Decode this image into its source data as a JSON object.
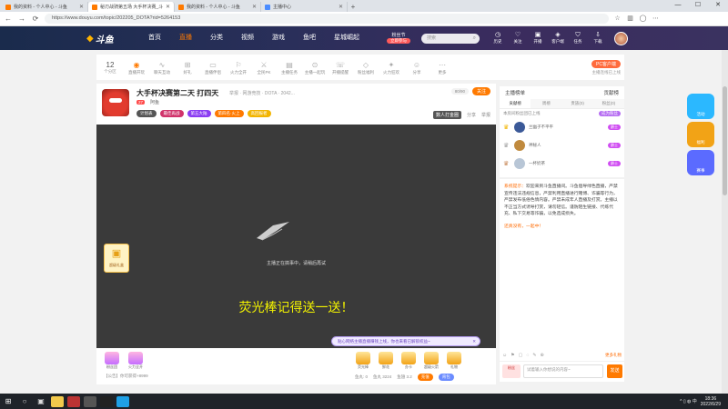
{
  "browser": {
    "tabs": [
      {
        "title": "我的资料 - 个人中心 - 斗鱼",
        "active": false
      },
      {
        "title": "秘刃战骑第五场 大手杯决赛_斗鱼直播平台",
        "active": true
      },
      {
        "title": "我的资料 - 个人中心 - 斗鱼",
        "active": false
      },
      {
        "title": "主播中心",
        "active": false
      }
    ],
    "url": "https://www.douyu.com/topic/202205_DOTA?rid=5264153",
    "new_tab": "+",
    "window_controls": [
      "—",
      "☐",
      "✕"
    ],
    "nav": {
      "back": "←",
      "forward": "→",
      "reload": "⟳"
    }
  },
  "site": {
    "logo_main": "斗鱼",
    "nav": [
      {
        "label": "首页",
        "active": false
      },
      {
        "label": "直播",
        "active": true
      },
      {
        "label": "分类",
        "active": false
      },
      {
        "label": "视频",
        "active": false
      },
      {
        "label": "游戏",
        "active": false
      },
      {
        "label": "鱼吧",
        "active": false
      },
      {
        "label": "星城崛起",
        "active": false
      }
    ],
    "festival": {
      "title": "粉丝节",
      "button": "立即参与"
    },
    "search_placeholder": "搜索",
    "header_icons": [
      {
        "icon": "history-icon",
        "glyph": "◷",
        "label": "历史"
      },
      {
        "icon": "follow-icon",
        "glyph": "♡",
        "label": "关注"
      },
      {
        "icon": "broadcast-icon",
        "glyph": "▣",
        "label": "开播"
      },
      {
        "icon": "customer-icon",
        "glyph": "◈",
        "label": "客户端"
      },
      {
        "icon": "task-icon",
        "glyph": "⛉",
        "label": "任务"
      },
      {
        "icon": "download-icon",
        "glyph": "⇩",
        "label": "下载"
      }
    ]
  },
  "category_bar": {
    "count": "12",
    "count_label": "个分区",
    "items": [
      {
        "label": "直播开玩",
        "hot": true,
        "glyph": "◉"
      },
      {
        "label": "聊天互动",
        "hot": false,
        "glyph": "∿"
      },
      {
        "label": "好礼",
        "hot": false,
        "glyph": "⊞"
      },
      {
        "label": "直播伴侣",
        "hot": false,
        "glyph": "▭"
      },
      {
        "label": "火力全开",
        "hot": false,
        "glyph": "⚐"
      },
      {
        "label": "全民PK",
        "hot": false,
        "glyph": "⚔"
      },
      {
        "label": "主播任务",
        "hot": false,
        "glyph": "▤"
      },
      {
        "label": "主播一起玩",
        "hot": false,
        "glyph": "⊙"
      },
      {
        "label": "开播提醒",
        "hot": false,
        "glyph": "☏"
      },
      {
        "label": "粉丝福利",
        "hot": false,
        "glyph": "◇"
      },
      {
        "label": "火力狂欢",
        "hot": false,
        "glyph": "✦"
      },
      {
        "label": "分享",
        "hot": false,
        "glyph": "☺"
      },
      {
        "label": "更多",
        "hot": false,
        "glyph": "⋯"
      }
    ],
    "right_button": "PC客户端",
    "right_sub": "主播连线已上线"
  },
  "room": {
    "title": "大手杯决赛第二天 打四天",
    "meta": "举报 · 网游竞技 · DOTA · 2042...",
    "level": "27",
    "host": "阿鱼",
    "follow_label": "关注",
    "count": "80/90",
    "badges": [
      {
        "label": "计划表",
        "color": "#555555"
      },
      {
        "label": "最佳再战",
        "color": "#d0336b"
      },
      {
        "label": "第五大陆",
        "color": "#8a3cf2"
      },
      {
        "label": "第四名·火上",
        "color": "#ff7a00"
      },
      {
        "label": "高回报者",
        "color": "#f2b400"
      }
    ],
    "tools": {
      "gold": "数人打金圈",
      "share": "分享",
      "report": "举报"
    },
    "video_message": "主播正在搞事中，请稍后再试",
    "caption": "荧光棒记得送一送！",
    "banner": "贴心网络主播直播赚钱上线，你也来看已解锁权益~",
    "side_gift": "超级礼盒"
  },
  "gift_bar": {
    "left": [
      {
        "label": "粉丝团"
      },
      {
        "label": "火力全开"
      }
    ],
    "announcement": "【公告】你可获得+8999",
    "mid": [
      {
        "label": "荧光棒"
      },
      {
        "label": "鲜花"
      },
      {
        "label": "办卡"
      },
      {
        "label": "超级火箭"
      },
      {
        "label": "礼物"
      }
    ],
    "bottom": {
      "level": "鱼丸: 0",
      "yuwan": "鱼丸 3224",
      "shark": "鱼翅 3.2",
      "charge": "充值",
      "pack": "背包"
    }
  },
  "rank": {
    "title": "主播榜单",
    "contribution": "贡献榜",
    "tabs": [
      {
        "label": "贡献榜",
        "active": true
      },
      {
        "label": "周榜",
        "active": false
      },
      {
        "label": "贵族(0)",
        "active": false
      },
      {
        "label": "粉丝(0)",
        "active": false
      }
    ],
    "note": "本房间粉丝团已上线",
    "note_btn": "成为粉丝",
    "rows": [
      {
        "name": "兰幽子不平平",
        "badge": "爵士",
        "crown": "1"
      },
      {
        "name": "神秘人",
        "badge": "爵士",
        "crown": "2"
      },
      {
        "name": "一杯奶茶",
        "badge": "爵士",
        "crown": "3"
      }
    ]
  },
  "chat": {
    "system_prefix": "系统提示：",
    "system_text": "欢迎来到斗鱼直播间。斗鱼倡导绿色直播，严禁宣传违法违规信息，严禁利用直播进行赌博、诈骗等行为，严禁发布低俗色情内容。严禁未成年人直播及打赏。主播以不正当方式诱导打赏，请勿轻信。谨防陌生链接、代练代充、私下交易等诈骗，以免造成损失。",
    "welcome": "还真没有，一起中！",
    "tools": [
      "☺",
      "⚑",
      "▢",
      "◌",
      "✎",
      "⊕"
    ],
    "tools_right": "更多礼物",
    "input_placeholder": "试着输入你想说的内容~",
    "avatar_label": "粉丝",
    "send": "发送"
  },
  "promo": [
    {
      "label": "活动",
      "color": "#2bb8ff"
    },
    {
      "label": "福利",
      "color": "#f2a316"
    },
    {
      "label": "赛事",
      "color": "#5b6bff"
    }
  ],
  "taskbar": {
    "start": "⊞",
    "search": "○",
    "taskview": "▣",
    "clock_time": "18:36",
    "clock_date": "2022/6/29",
    "tray": "^ ▯ ◍ 中"
  }
}
